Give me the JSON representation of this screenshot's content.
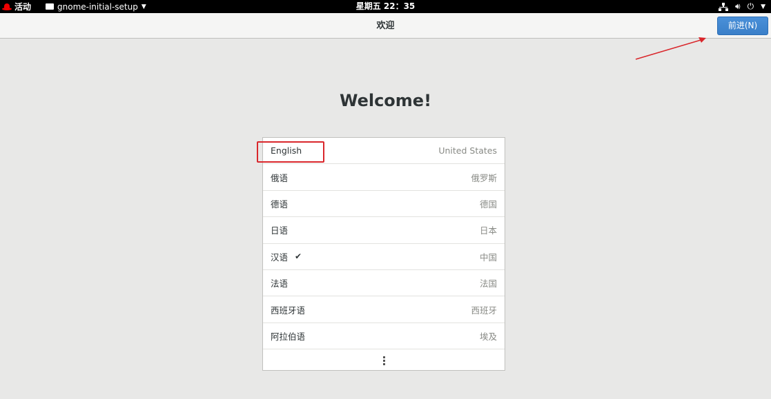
{
  "topbar": {
    "activities": "活动",
    "app_name": "gnome-initial-setup",
    "clock": "星期五 22：35"
  },
  "header": {
    "title": "欢迎",
    "next_button": "前进(N)"
  },
  "welcome_title": "Welcome!",
  "languages": [
    {
      "name": "English",
      "region": "United States",
      "selected": false
    },
    {
      "name": "俄语",
      "region": "俄罗斯",
      "selected": false
    },
    {
      "name": "德语",
      "region": "德国",
      "selected": false
    },
    {
      "name": "日语",
      "region": "日本",
      "selected": false
    },
    {
      "name": "汉语",
      "region": "中国",
      "selected": true
    },
    {
      "name": "法语",
      "region": "法国",
      "selected": false
    },
    {
      "name": "西班牙语",
      "region": "西班牙",
      "selected": false
    },
    {
      "name": "阿拉伯语",
      "region": "埃及",
      "selected": false
    }
  ],
  "icons": {
    "logo": "redhat-logo-icon",
    "app": "window-icon",
    "network": "network-icon",
    "volume": "volume-icon",
    "power": "power-icon",
    "check": "checkmark-icon",
    "more": "more-vertical-icon"
  },
  "colors": {
    "accent": "#3a7fc8",
    "annotation": "#d9262b"
  }
}
